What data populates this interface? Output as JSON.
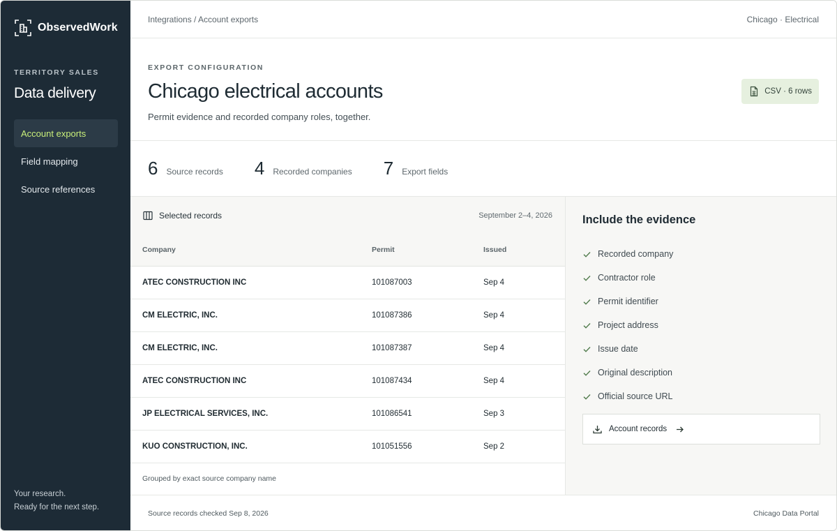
{
  "brand": {
    "name": "ObservedWork",
    "logo_icon": "building-scan-icon"
  },
  "sidebar": {
    "eyebrow": "TERRITORY SALES",
    "title": "Data delivery",
    "items": [
      {
        "label": "Account exports",
        "active": true
      },
      {
        "label": "Field mapping",
        "active": false
      },
      {
        "label": "Source references",
        "active": false
      }
    ],
    "footer_line1": "Your research.",
    "footer_line2": "Ready for the next step."
  },
  "topbar": {
    "breadcrumb": "Integrations / Account exports",
    "context": "Chicago · Electrical"
  },
  "header": {
    "eyebrow": "EXPORT CONFIGURATION",
    "title": "Chicago electrical accounts",
    "subtitle": "Permit evidence and recorded company roles, together.",
    "badge": "CSV · 6 rows"
  },
  "stats": [
    {
      "value": "6",
      "label": "Source records"
    },
    {
      "value": "4",
      "label": "Recorded companies"
    },
    {
      "value": "7",
      "label": "Export fields"
    }
  ],
  "records": {
    "title": "Selected records",
    "date_range": "September 2–4, 2026",
    "columns": [
      "Company",
      "Permit",
      "Issued"
    ],
    "rows": [
      {
        "company": "ATEC CONSTRUCTION INC",
        "permit": "101087003",
        "issued": "Sep 4"
      },
      {
        "company": "CM ELECTRIC, INC.",
        "permit": "101087386",
        "issued": "Sep 4"
      },
      {
        "company": "CM ELECTRIC, INC.",
        "permit": "101087387",
        "issued": "Sep 4"
      },
      {
        "company": "ATEC CONSTRUCTION INC",
        "permit": "101087434",
        "issued": "Sep 4"
      },
      {
        "company": "JP ELECTRICAL SERVICES, INC.",
        "permit": "101086541",
        "issued": "Sep 3"
      },
      {
        "company": "KUO CONSTRUCTION, INC.",
        "permit": "101051556",
        "issued": "Sep 2"
      }
    ],
    "footer": "Grouped by exact source company name"
  },
  "evidence": {
    "title": "Include the evidence",
    "items": [
      "Recorded company",
      "Contractor role",
      "Permit identifier",
      "Project address",
      "Issue date",
      "Original description",
      "Official source URL"
    ],
    "button_label": "Account records"
  },
  "footer": {
    "checked": "Source records checked Sep 8, 2026",
    "source": "Chicago Data Portal"
  },
  "colors": {
    "sidebar_bg": "#1d2b36",
    "active_nav_text": "#c9ef7a",
    "badge_bg": "#e6f0df",
    "check": "#4f7a4a"
  }
}
